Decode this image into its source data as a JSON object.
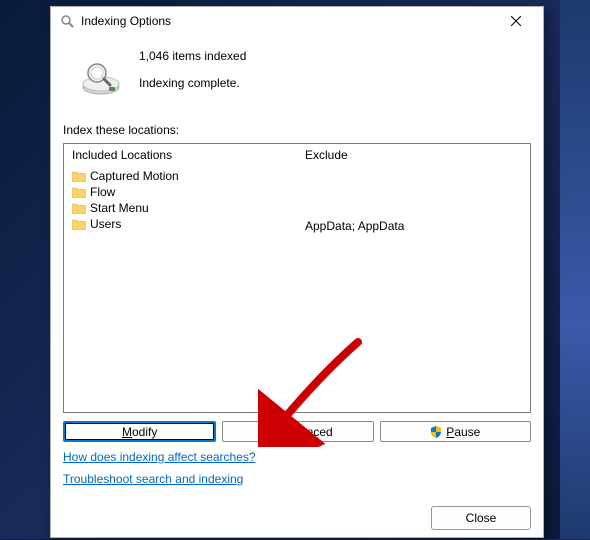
{
  "window": {
    "title": "Indexing Options"
  },
  "status": {
    "count_line": "1,046 items indexed",
    "state_line": "Indexing complete."
  },
  "section_label": "Index these locations:",
  "columns": {
    "included": "Included Locations",
    "exclude": "Exclude"
  },
  "locations": [
    {
      "name": "Captured Motion",
      "exclude": ""
    },
    {
      "name": "Flow",
      "exclude": ""
    },
    {
      "name": "Start Menu",
      "exclude": ""
    },
    {
      "name": "Users",
      "exclude": "AppData; AppData"
    }
  ],
  "buttons": {
    "modify": "Modify",
    "advanced": "Advanced",
    "pause": "Pause",
    "close": "Close"
  },
  "links": {
    "how": "How does indexing affect searches?",
    "troubleshoot": "Troubleshoot search and indexing"
  }
}
